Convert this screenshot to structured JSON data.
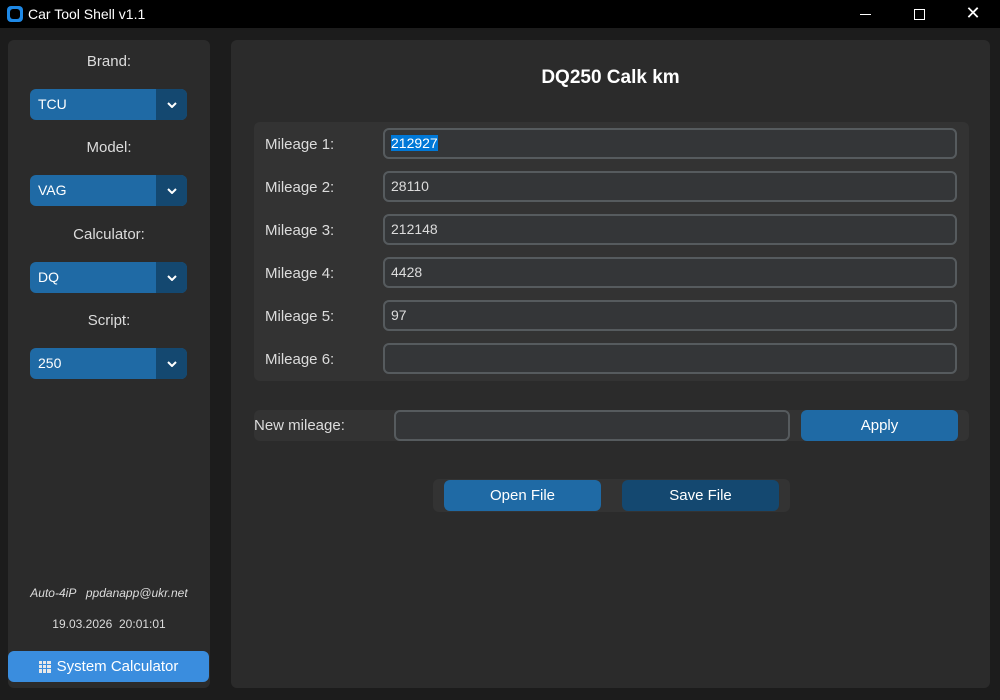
{
  "window": {
    "title": "Car Tool Shell v1.1",
    "minimize_glyph": "",
    "maximize_glyph": "",
    "close_glyph": "✕"
  },
  "sidebar": {
    "brand": {
      "label": "Brand:",
      "value": "TCU"
    },
    "model": {
      "label": "Model:",
      "value": "VAG"
    },
    "calculator": {
      "label": "Calculator:",
      "value": "DQ"
    },
    "script": {
      "label": "Script:",
      "value": "250"
    },
    "author": "Auto-4iP   ppdanapp@ukr.net",
    "datetime": "19.03.2026  20:01:01",
    "system_calculator_label": "System Calculator"
  },
  "main": {
    "title": "DQ250 Calk km",
    "mileages": [
      {
        "label": "Mileage 1:",
        "value": "212927",
        "selected": true
      },
      {
        "label": "Mileage 2:",
        "value": "28110"
      },
      {
        "label": "Mileage 3:",
        "value": "212148"
      },
      {
        "label": "Mileage 4:",
        "value": "4428"
      },
      {
        "label": "Mileage 5:",
        "value": "97"
      },
      {
        "label": "Mileage 6:",
        "value": ""
      }
    ],
    "new_mileage": {
      "label": "New mileage:",
      "value": ""
    },
    "apply_label": "Apply",
    "open_file_label": "Open File",
    "save_file_label": "Save File"
  },
  "colors": {
    "accent": "#1f6aa5",
    "accent_dark": "#144870",
    "accent_light": "#3a8dde",
    "panel": "#2b2b2b",
    "background": "#1c1c1c",
    "selection": "#0078d7"
  },
  "icons": {
    "app": "app-icon",
    "dropdown": "chevron-down-icon",
    "calculator": "calculator-icon"
  }
}
